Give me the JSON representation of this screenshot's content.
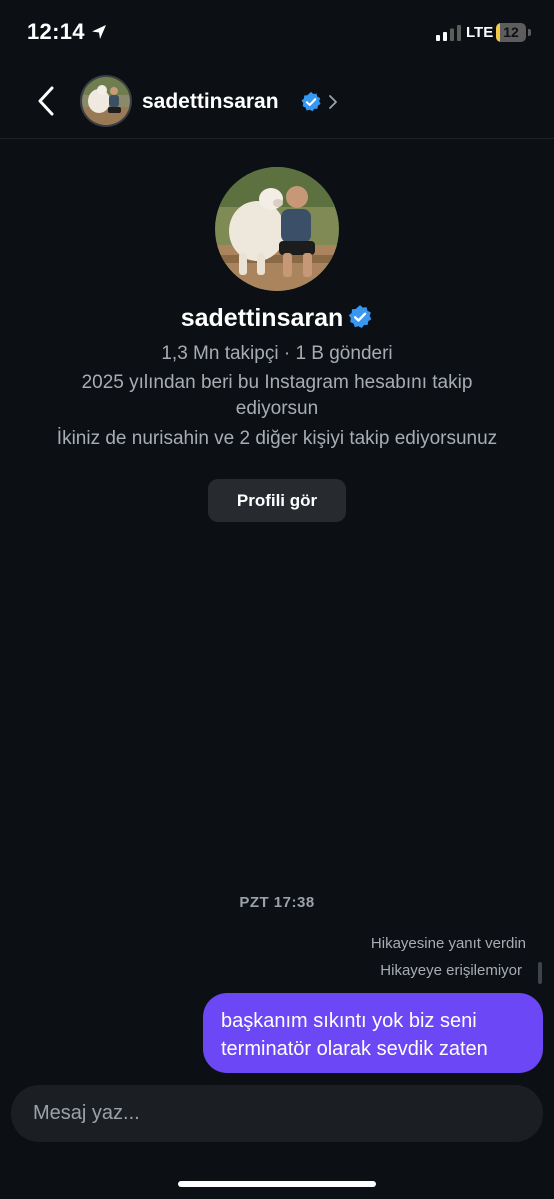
{
  "status_bar": {
    "time": "12:14",
    "network": "LTE",
    "battery": "12",
    "battery_level": 0.12
  },
  "header": {
    "username": "sadettinsaran"
  },
  "profile": {
    "name": "sadettinsaran",
    "stats": "1,3 Mn takipçi · 1 B gönderi",
    "since": "2025 yılından beri bu Instagram hesabını takip ediyorsun",
    "mutual": "İkiniz de nurisahin ve 2 diğer kişiyi takip ediyorsunuz",
    "view_profile_label": "Profili gör"
  },
  "conversation": {
    "timestamp": "PZT 17:38",
    "story_reply_note": "Hikayesine yanıt verdin",
    "story_unavailable_note": "Hikayeye erişilemiyor",
    "messages": [
      {
        "text": "başkanım sıkıntı yok biz seni terminatör olarak sevdik zaten",
        "sender": "me"
      }
    ]
  },
  "composer": {
    "placeholder": "Mesaj yaz..."
  },
  "colors": {
    "background": "#0c1014",
    "bubble": "#6b47f5",
    "verified": "#3897f0"
  }
}
